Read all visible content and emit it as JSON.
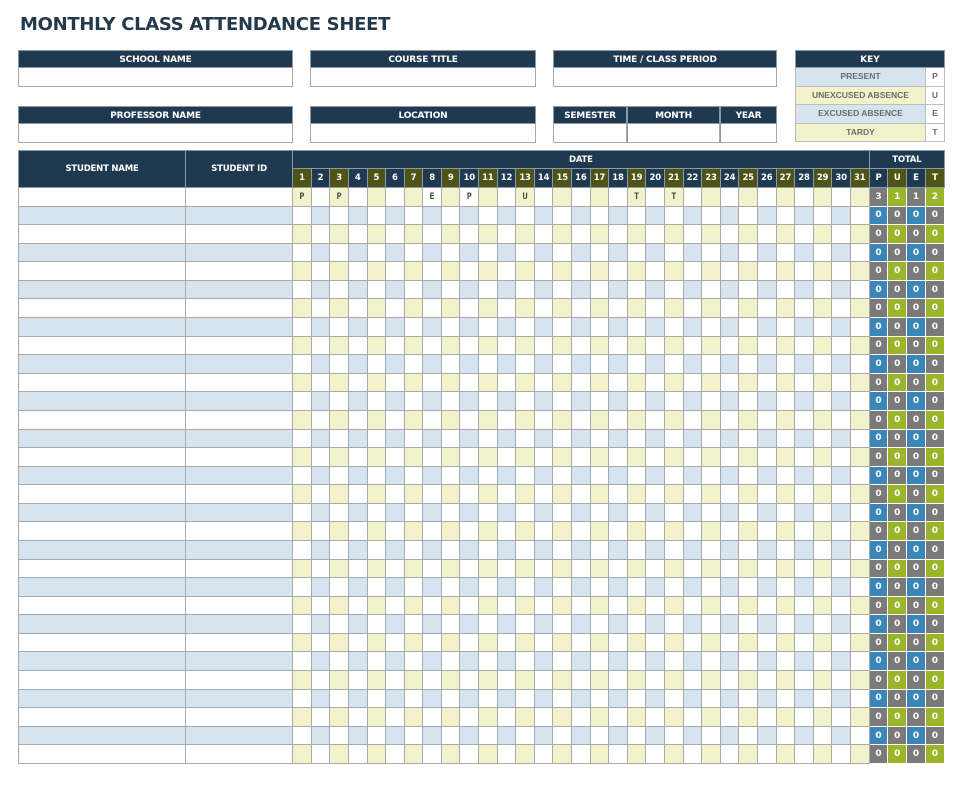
{
  "title": "MONTHLY CLASS ATTENDANCE SHEET",
  "fields": {
    "school_name": {
      "label": "SCHOOL NAME",
      "value": ""
    },
    "course_title": {
      "label": "COURSE TITLE",
      "value": ""
    },
    "time_class_period": {
      "label": "TIME / CLASS PERIOD",
      "value": ""
    },
    "professor_name": {
      "label": "PROFESSOR NAME",
      "value": ""
    },
    "location": {
      "label": "LOCATION",
      "value": ""
    },
    "semester": {
      "label": "SEMESTER",
      "value": ""
    },
    "month": {
      "label": "MONTH",
      "value": ""
    },
    "year": {
      "label": "YEAR",
      "value": ""
    }
  },
  "key": {
    "title": "KEY",
    "items": [
      {
        "label": "PRESENT",
        "code": "P"
      },
      {
        "label": "UNEXCUSED ABSENCE",
        "code": "U"
      },
      {
        "label": "EXCUSED ABSENCE",
        "code": "E"
      },
      {
        "label": "TARDY",
        "code": "T"
      }
    ]
  },
  "table": {
    "student_name_header": "STUDENT NAME",
    "student_id_header": "STUDENT ID",
    "date_header": "DATE",
    "total_header": "TOTAL",
    "days": [
      "1",
      "2",
      "3",
      "4",
      "5",
      "6",
      "7",
      "8",
      "9",
      "10",
      "11",
      "12",
      "13",
      "14",
      "15",
      "16",
      "17",
      "18",
      "19",
      "20",
      "21",
      "22",
      "23",
      "24",
      "25",
      "26",
      "27",
      "28",
      "29",
      "30",
      "31"
    ],
    "total_columns": [
      "P",
      "U",
      "E",
      "T"
    ],
    "rows": [
      {
        "name": "",
        "id": "",
        "marks": {
          "1": "P",
          "3": "P",
          "8": "E",
          "10": "P",
          "13": "U",
          "19": "T",
          "21": "T"
        },
        "totals": [
          3,
          1,
          1,
          2
        ]
      },
      {
        "name": "",
        "id": "",
        "marks": {},
        "totals": [
          0,
          0,
          0,
          0
        ]
      },
      {
        "name": "",
        "id": "",
        "marks": {},
        "totals": [
          0,
          0,
          0,
          0
        ]
      },
      {
        "name": "",
        "id": "",
        "marks": {},
        "totals": [
          0,
          0,
          0,
          0
        ]
      },
      {
        "name": "",
        "id": "",
        "marks": {},
        "totals": [
          0,
          0,
          0,
          0
        ]
      },
      {
        "name": "",
        "id": "",
        "marks": {},
        "totals": [
          0,
          0,
          0,
          0
        ]
      },
      {
        "name": "",
        "id": "",
        "marks": {},
        "totals": [
          0,
          0,
          0,
          0
        ]
      },
      {
        "name": "",
        "id": "",
        "marks": {},
        "totals": [
          0,
          0,
          0,
          0
        ]
      },
      {
        "name": "",
        "id": "",
        "marks": {},
        "totals": [
          0,
          0,
          0,
          0
        ]
      },
      {
        "name": "",
        "id": "",
        "marks": {},
        "totals": [
          0,
          0,
          0,
          0
        ]
      },
      {
        "name": "",
        "id": "",
        "marks": {},
        "totals": [
          0,
          0,
          0,
          0
        ]
      },
      {
        "name": "",
        "id": "",
        "marks": {},
        "totals": [
          0,
          0,
          0,
          0
        ]
      },
      {
        "name": "",
        "id": "",
        "marks": {},
        "totals": [
          0,
          0,
          0,
          0
        ]
      },
      {
        "name": "",
        "id": "",
        "marks": {},
        "totals": [
          0,
          0,
          0,
          0
        ]
      },
      {
        "name": "",
        "id": "",
        "marks": {},
        "totals": [
          0,
          0,
          0,
          0
        ]
      },
      {
        "name": "",
        "id": "",
        "marks": {},
        "totals": [
          0,
          0,
          0,
          0
        ]
      },
      {
        "name": "",
        "id": "",
        "marks": {},
        "totals": [
          0,
          0,
          0,
          0
        ]
      },
      {
        "name": "",
        "id": "",
        "marks": {},
        "totals": [
          0,
          0,
          0,
          0
        ]
      },
      {
        "name": "",
        "id": "",
        "marks": {},
        "totals": [
          0,
          0,
          0,
          0
        ]
      },
      {
        "name": "",
        "id": "",
        "marks": {},
        "totals": [
          0,
          0,
          0,
          0
        ]
      },
      {
        "name": "",
        "id": "",
        "marks": {},
        "totals": [
          0,
          0,
          0,
          0
        ]
      },
      {
        "name": "",
        "id": "",
        "marks": {},
        "totals": [
          0,
          0,
          0,
          0
        ]
      },
      {
        "name": "",
        "id": "",
        "marks": {},
        "totals": [
          0,
          0,
          0,
          0
        ]
      },
      {
        "name": "",
        "id": "",
        "marks": {},
        "totals": [
          0,
          0,
          0,
          0
        ]
      },
      {
        "name": "",
        "id": "",
        "marks": {},
        "totals": [
          0,
          0,
          0,
          0
        ]
      },
      {
        "name": "",
        "id": "",
        "marks": {},
        "totals": [
          0,
          0,
          0,
          0
        ]
      },
      {
        "name": "",
        "id": "",
        "marks": {},
        "totals": [
          0,
          0,
          0,
          0
        ]
      },
      {
        "name": "",
        "id": "",
        "marks": {},
        "totals": [
          0,
          0,
          0,
          0
        ]
      },
      {
        "name": "",
        "id": "",
        "marks": {},
        "totals": [
          0,
          0,
          0,
          0
        ]
      },
      {
        "name": "",
        "id": "",
        "marks": {},
        "totals": [
          0,
          0,
          0,
          0
        ]
      },
      {
        "name": "",
        "id": "",
        "marks": {},
        "totals": [
          0,
          0,
          0,
          0
        ]
      }
    ]
  },
  "colors": {
    "header_navy": "#1f3a50",
    "header_olive": "#4e5316",
    "row_blue": "#d6e4ef",
    "cell_cream": "#f2f3cb",
    "total_gray": "#7a7a7a",
    "total_green": "#9bb52a",
    "total_blue": "#3a86b8"
  }
}
